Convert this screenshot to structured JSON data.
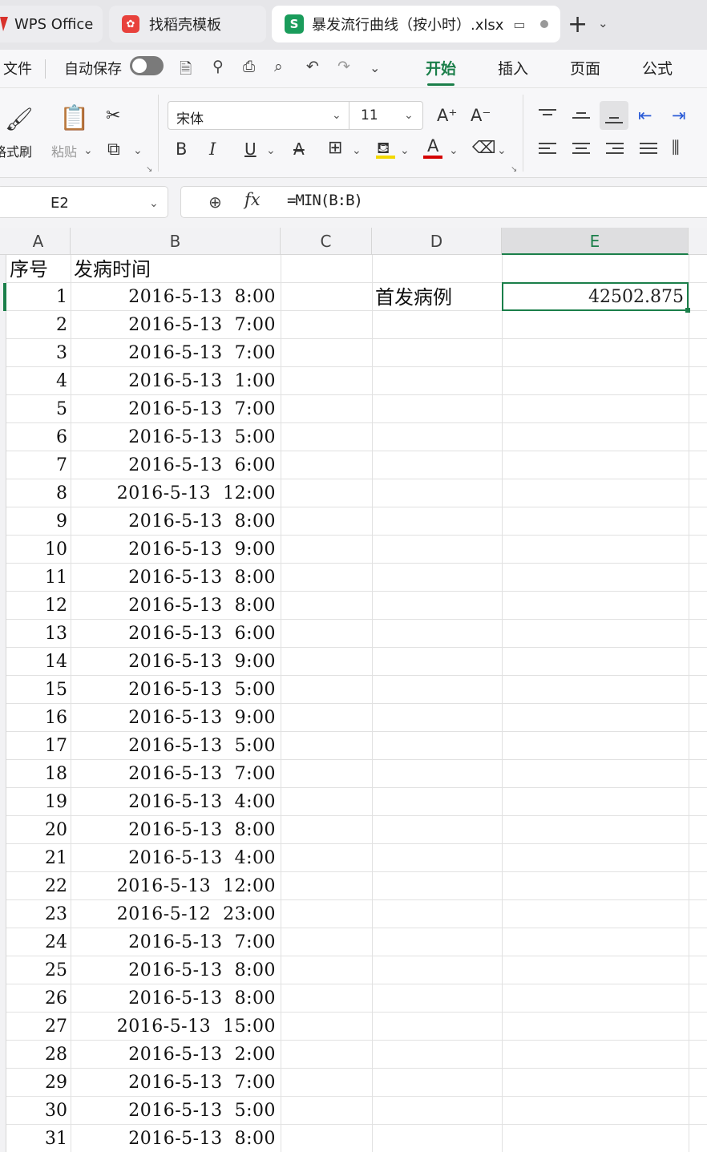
{
  "tabs": {
    "wps": "WPS Office",
    "daoke": "找稻壳模板",
    "file": "暴发流行曲线（按小时）.xlsx",
    "wps_logo": "wps-logo",
    "daoke_logo": "daoke-logo",
    "sheet_logo": "S"
  },
  "menu": {
    "file": "文件",
    "autosave": "自动保存",
    "ribbon_tabs": [
      "开始",
      "插入",
      "页面",
      "公式"
    ]
  },
  "ribbon": {
    "format_painter": "格式刷",
    "paste": "粘贴",
    "font_name": "宋体",
    "font_size": "11",
    "bold": "B",
    "italic": "I",
    "underline": "U",
    "font_color_letter": "A",
    "grow_font": "A⁺",
    "shrink_font": "A⁻"
  },
  "formula_bar": {
    "cell_ref": "E2",
    "fx": "fx",
    "formula": "=MIN(B:B)"
  },
  "grid": {
    "columns": [
      "A",
      "B",
      "C",
      "D",
      "E"
    ],
    "selected_column": "E",
    "header_row": {
      "a": "序号",
      "b": "发病时间"
    },
    "label_d2": "首发病例",
    "value_e2": "42502.875",
    "rows": [
      {
        "n": "1",
        "t": "2016-5-13  8:00"
      },
      {
        "n": "2",
        "t": "2016-5-13  7:00"
      },
      {
        "n": "3",
        "t": "2016-5-13  7:00"
      },
      {
        "n": "4",
        "t": "2016-5-13  1:00"
      },
      {
        "n": "5",
        "t": "2016-5-13  7:00"
      },
      {
        "n": "6",
        "t": "2016-5-13  5:00"
      },
      {
        "n": "7",
        "t": "2016-5-13  6:00"
      },
      {
        "n": "8",
        "t": "2016-5-13  12:00"
      },
      {
        "n": "9",
        "t": "2016-5-13  8:00"
      },
      {
        "n": "10",
        "t": "2016-5-13  9:00"
      },
      {
        "n": "11",
        "t": "2016-5-13  8:00"
      },
      {
        "n": "12",
        "t": "2016-5-13  8:00"
      },
      {
        "n": "13",
        "t": "2016-5-13  6:00"
      },
      {
        "n": "14",
        "t": "2016-5-13  9:00"
      },
      {
        "n": "15",
        "t": "2016-5-13  5:00"
      },
      {
        "n": "16",
        "t": "2016-5-13  9:00"
      },
      {
        "n": "17",
        "t": "2016-5-13  5:00"
      },
      {
        "n": "18",
        "t": "2016-5-13  7:00"
      },
      {
        "n": "19",
        "t": "2016-5-13  4:00"
      },
      {
        "n": "20",
        "t": "2016-5-13  8:00"
      },
      {
        "n": "21",
        "t": "2016-5-13  4:00"
      },
      {
        "n": "22",
        "t": "2016-5-13  12:00"
      },
      {
        "n": "23",
        "t": "2016-5-12  23:00"
      },
      {
        "n": "24",
        "t": "2016-5-13  7:00"
      },
      {
        "n": "25",
        "t": "2016-5-13  8:00"
      },
      {
        "n": "26",
        "t": "2016-5-13  8:00"
      },
      {
        "n": "27",
        "t": "2016-5-13  15:00"
      },
      {
        "n": "28",
        "t": "2016-5-13  2:00"
      },
      {
        "n": "29",
        "t": "2016-5-13  7:00"
      },
      {
        "n": "30",
        "t": "2016-5-13  5:00"
      },
      {
        "n": "31",
        "t": "2016-5-13  8:00"
      }
    ]
  },
  "colors": {
    "accent": "#1b7f4a",
    "sheet_logo": "#1a9c5b",
    "highlight_bar": "#f2d800",
    "font_color_bar": "#d40000"
  }
}
